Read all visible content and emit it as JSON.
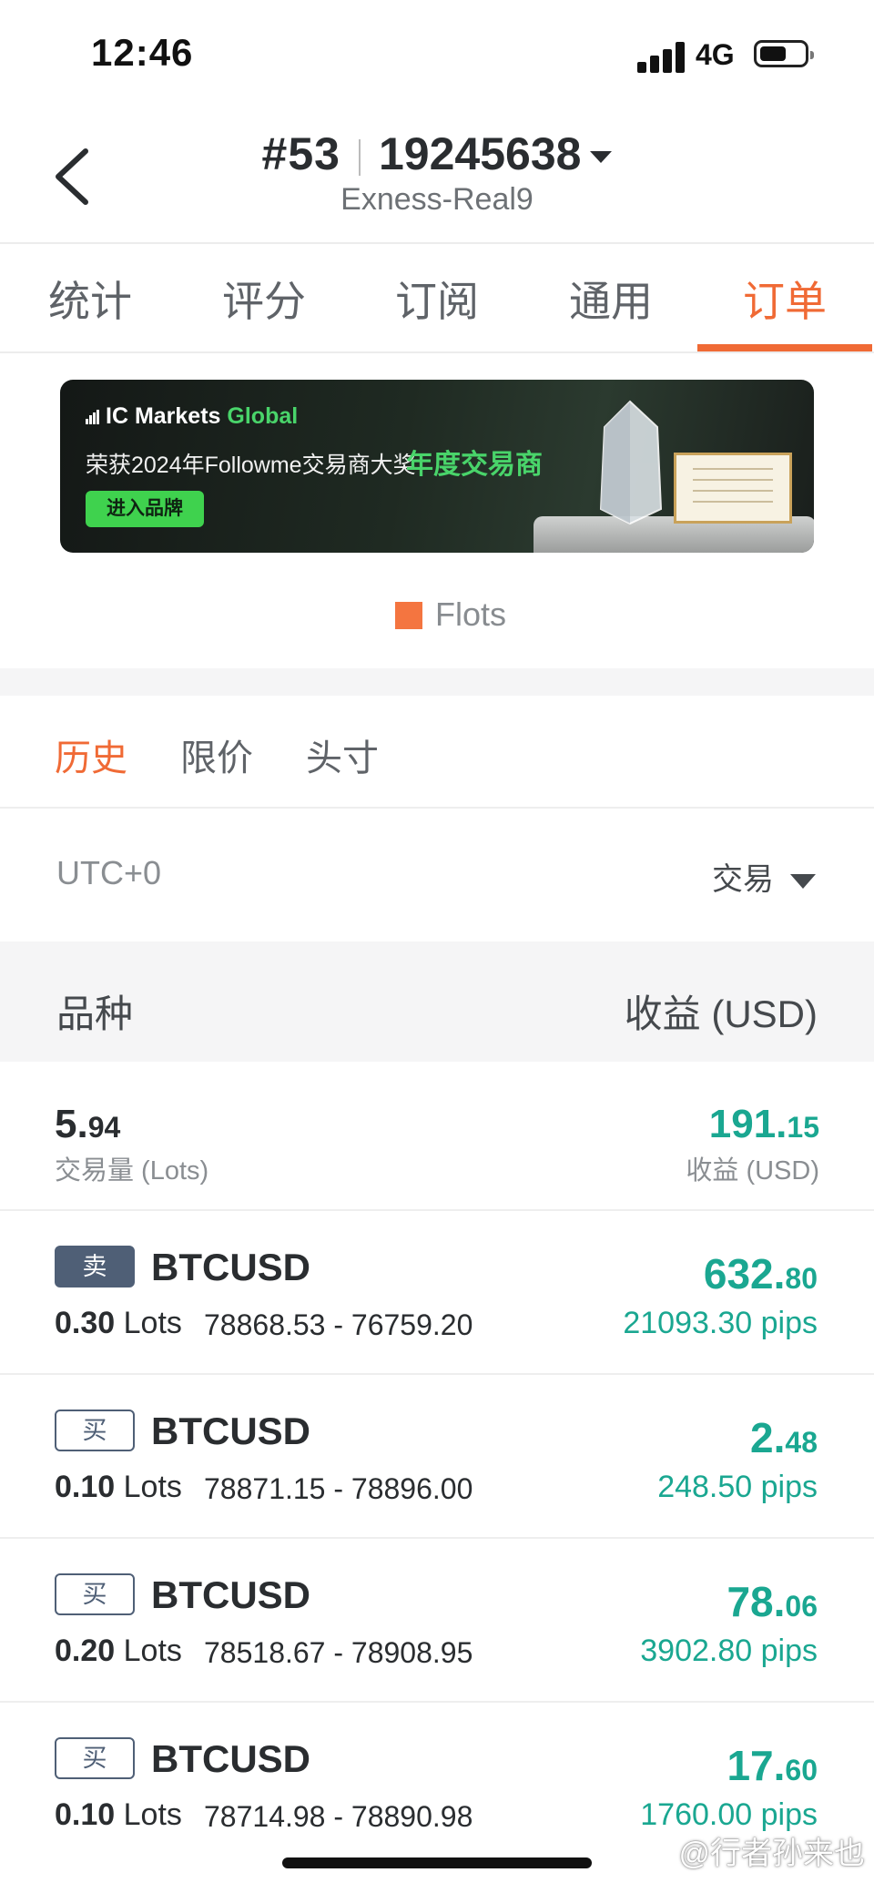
{
  "status_bar": {
    "time": "12:46",
    "network": "4G",
    "battery_level": 0.6
  },
  "header": {
    "rank": "#53",
    "account_number": "19245638",
    "server": "Exness-Real9"
  },
  "tabs": [
    {
      "label": "统计"
    },
    {
      "label": "评分"
    },
    {
      "label": "订阅"
    },
    {
      "label": "通用"
    },
    {
      "label": "订单",
      "active": true
    }
  ],
  "banner": {
    "brand_prefix": "IC Markets",
    "brand_suffix": "Global",
    "award_text": "荣获2024年Followme交易商大奖",
    "award_title": "年度交易商",
    "button_label": "进入品牌"
  },
  "legend": {
    "label": "Flots",
    "color": "#f47540"
  },
  "subtabs": [
    {
      "label": "历史",
      "active": true
    },
    {
      "label": "限价"
    },
    {
      "label": "头寸"
    }
  ],
  "filter_bar": {
    "timezone": "UTC+0",
    "filter_label": "交易"
  },
  "columns": {
    "left": "品种",
    "right": "收益 (USD)"
  },
  "summary": {
    "volume_int": "5.",
    "volume_dec": "94",
    "volume_label": "交易量 (Lots)",
    "profit_int": "191.",
    "profit_dec": "15",
    "profit_label": "收益 (USD)"
  },
  "orders": [
    {
      "side": "卖",
      "type": "sell",
      "symbol": "BTCUSD",
      "lots": "0.30",
      "lots_unit": "Lots",
      "prices": "78868.53 - 76759.20",
      "profit_int": "632.",
      "profit_dec": "80",
      "pips": "21093.30 pips"
    },
    {
      "side": "买",
      "type": "buy",
      "symbol": "BTCUSD",
      "lots": "0.10",
      "lots_unit": "Lots",
      "prices": "78871.15 - 78896.00",
      "profit_int": "2.",
      "profit_dec": "48",
      "pips": "248.50 pips"
    },
    {
      "side": "买",
      "type": "buy",
      "symbol": "BTCUSD",
      "lots": "0.20",
      "lots_unit": "Lots",
      "prices": "78518.67 - 78908.95",
      "profit_int": "78.",
      "profit_dec": "06",
      "pips": "3902.80 pips"
    },
    {
      "side": "买",
      "type": "buy",
      "symbol": "BTCUSD",
      "lots": "0.10",
      "lots_unit": "Lots",
      "prices": "78714.98 - 78890.98",
      "profit_int": "17.",
      "profit_dec": "60",
      "pips": "1760.00 pips"
    }
  ],
  "watermark": "@行者孙来也"
}
